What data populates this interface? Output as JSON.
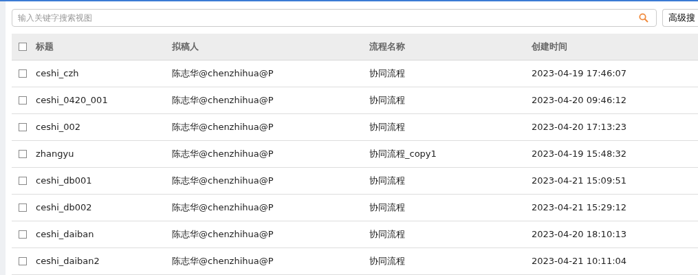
{
  "search": {
    "placeholder": "输入关键字搜索视图"
  },
  "advanced_search_button": "高级搜",
  "table": {
    "select_all_checked": false,
    "columns": [
      "标题",
      "拟稿人",
      "流程名称",
      "创建时间"
    ],
    "rows": [
      {
        "checked": false,
        "cells": [
          "ceshi_czh",
          "陈志华@chenzhihua@P",
          "协同流程",
          "2023-04-19 17:46:07"
        ]
      },
      {
        "checked": false,
        "cells": [
          "ceshi_0420_001",
          "陈志华@chenzhihua@P",
          "协同流程",
          "2023-04-20 09:46:12"
        ]
      },
      {
        "checked": false,
        "cells": [
          "ceshi_002",
          "陈志华@chenzhihua@P",
          "协同流程",
          "2023-04-20 17:13:23"
        ]
      },
      {
        "checked": false,
        "cells": [
          "zhangyu",
          "陈志华@chenzhihua@P",
          "协同流程_copy1",
          "2023-04-19 15:48:32"
        ]
      },
      {
        "checked": false,
        "cells": [
          "ceshi_db001",
          "陈志华@chenzhihua@P",
          "协同流程",
          "2023-04-21 15:09:51"
        ]
      },
      {
        "checked": false,
        "cells": [
          "ceshi_db002",
          "陈志华@chenzhihua@P",
          "协同流程",
          "2023-04-21 15:29:12"
        ]
      },
      {
        "checked": false,
        "cells": [
          "ceshi_daiban",
          "陈志华@chenzhihua@P",
          "协同流程",
          "2023-04-20 18:10:13"
        ]
      },
      {
        "checked": false,
        "cells": [
          "ceshi_daiban2",
          "陈志华@chenzhihua@P",
          "协同流程",
          "2023-04-21 10:11:04"
        ]
      }
    ]
  }
}
